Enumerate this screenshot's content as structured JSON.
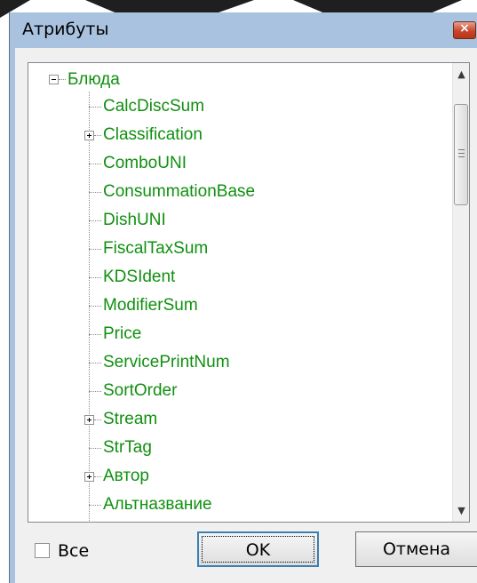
{
  "dialog": {
    "title": "Атрибуты",
    "close_glyph": "×"
  },
  "tree": {
    "root": {
      "label": "Блюда",
      "expanded": true
    },
    "items": [
      {
        "label": "CalcDiscSum",
        "expandable": false
      },
      {
        "label": "Classification",
        "expandable": true
      },
      {
        "label": "ComboUNI",
        "expandable": false
      },
      {
        "label": "ConsummationBase",
        "expandable": false
      },
      {
        "label": "DishUNI",
        "expandable": false
      },
      {
        "label": "FiscalTaxSum",
        "expandable": false
      },
      {
        "label": "KDSIdent",
        "expandable": false
      },
      {
        "label": "ModifierSum",
        "expandable": false
      },
      {
        "label": "Price",
        "expandable": false
      },
      {
        "label": "ServicePrintNum",
        "expandable": false
      },
      {
        "label": "SortOrder",
        "expandable": false
      },
      {
        "label": "Stream",
        "expandable": true
      },
      {
        "label": "StrTag",
        "expandable": false
      },
      {
        "label": "Автор",
        "expandable": true
      },
      {
        "label": "Альтназвание",
        "expandable": false
      }
    ],
    "text_color": "#109010"
  },
  "footer": {
    "all_checkbox_label": "Все",
    "all_checked": false,
    "ok_label": "OK",
    "cancel_label": "Отмена"
  }
}
